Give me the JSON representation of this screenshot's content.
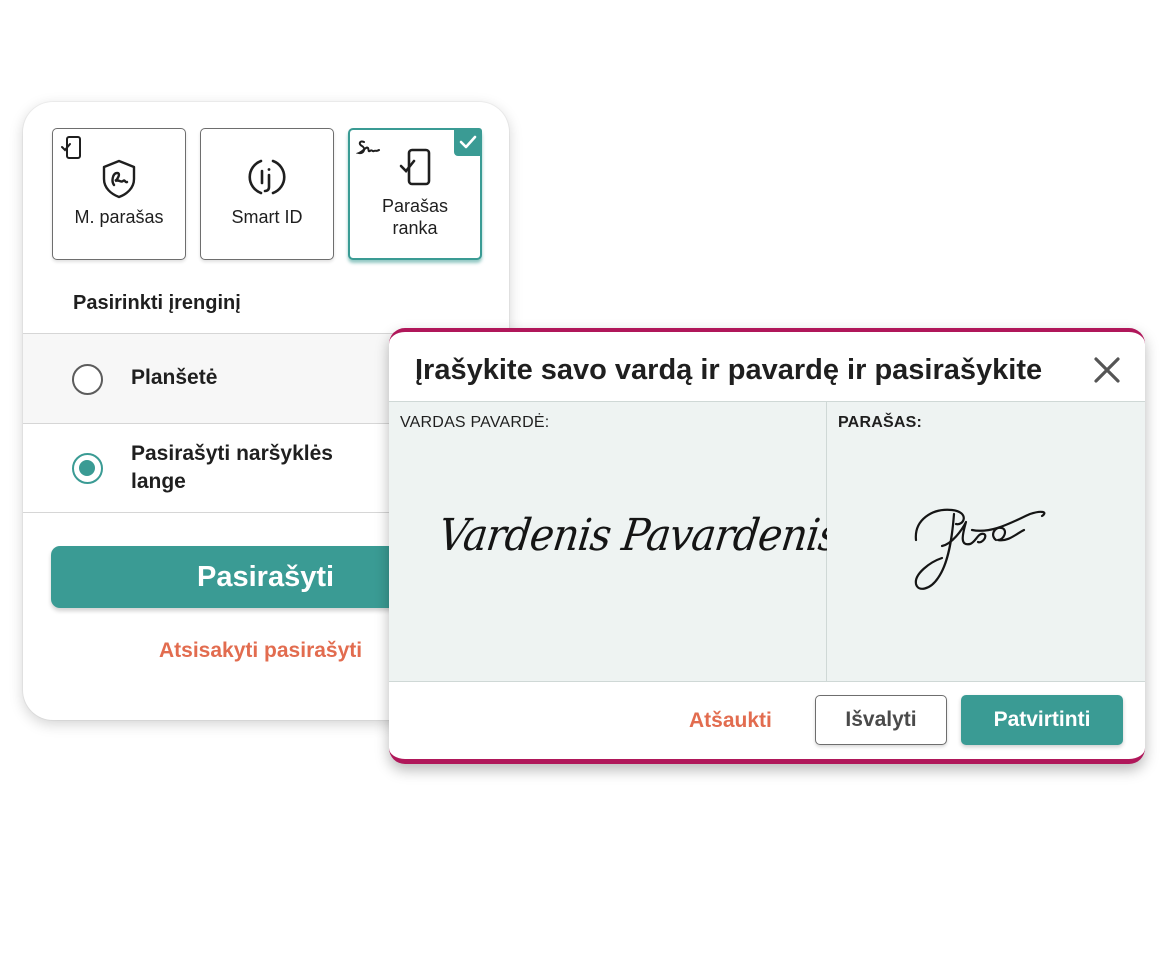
{
  "signing_card": {
    "methods": [
      {
        "label": "M. parašas",
        "icon": "mobile-signature-shield-icon",
        "selected": false
      },
      {
        "label": "Smart ID",
        "icon": "smart-id-icon",
        "selected": false
      },
      {
        "label": "Parašas\nranka",
        "icon": "tablet-check-icon",
        "selected": true
      }
    ],
    "device_title": "Pasirinkti įrenginį",
    "devices": [
      {
        "label": "Planšetė",
        "selected": false
      },
      {
        "label": "Pasirašyti naršyklės\nlange",
        "selected": true
      }
    ],
    "sign_button": "Pasirašyti",
    "cancel_link": "Atsisakyti pasirašyti"
  },
  "modal": {
    "title": "Įrašykite savo vardą ir pavardę ir pasirašykite",
    "name_label": "VARDAS PAVARDĖ:",
    "name_value": "Vardenis Pavardenis",
    "signature_label": "PARAŠAS:",
    "cancel_button": "Atšaukti",
    "clear_button": "Išvalyti",
    "confirm_button": "Patvirtinti"
  },
  "colors": {
    "accent": "#3a9b94",
    "modal_border": "#b0175a",
    "link": "#e26c4f"
  }
}
